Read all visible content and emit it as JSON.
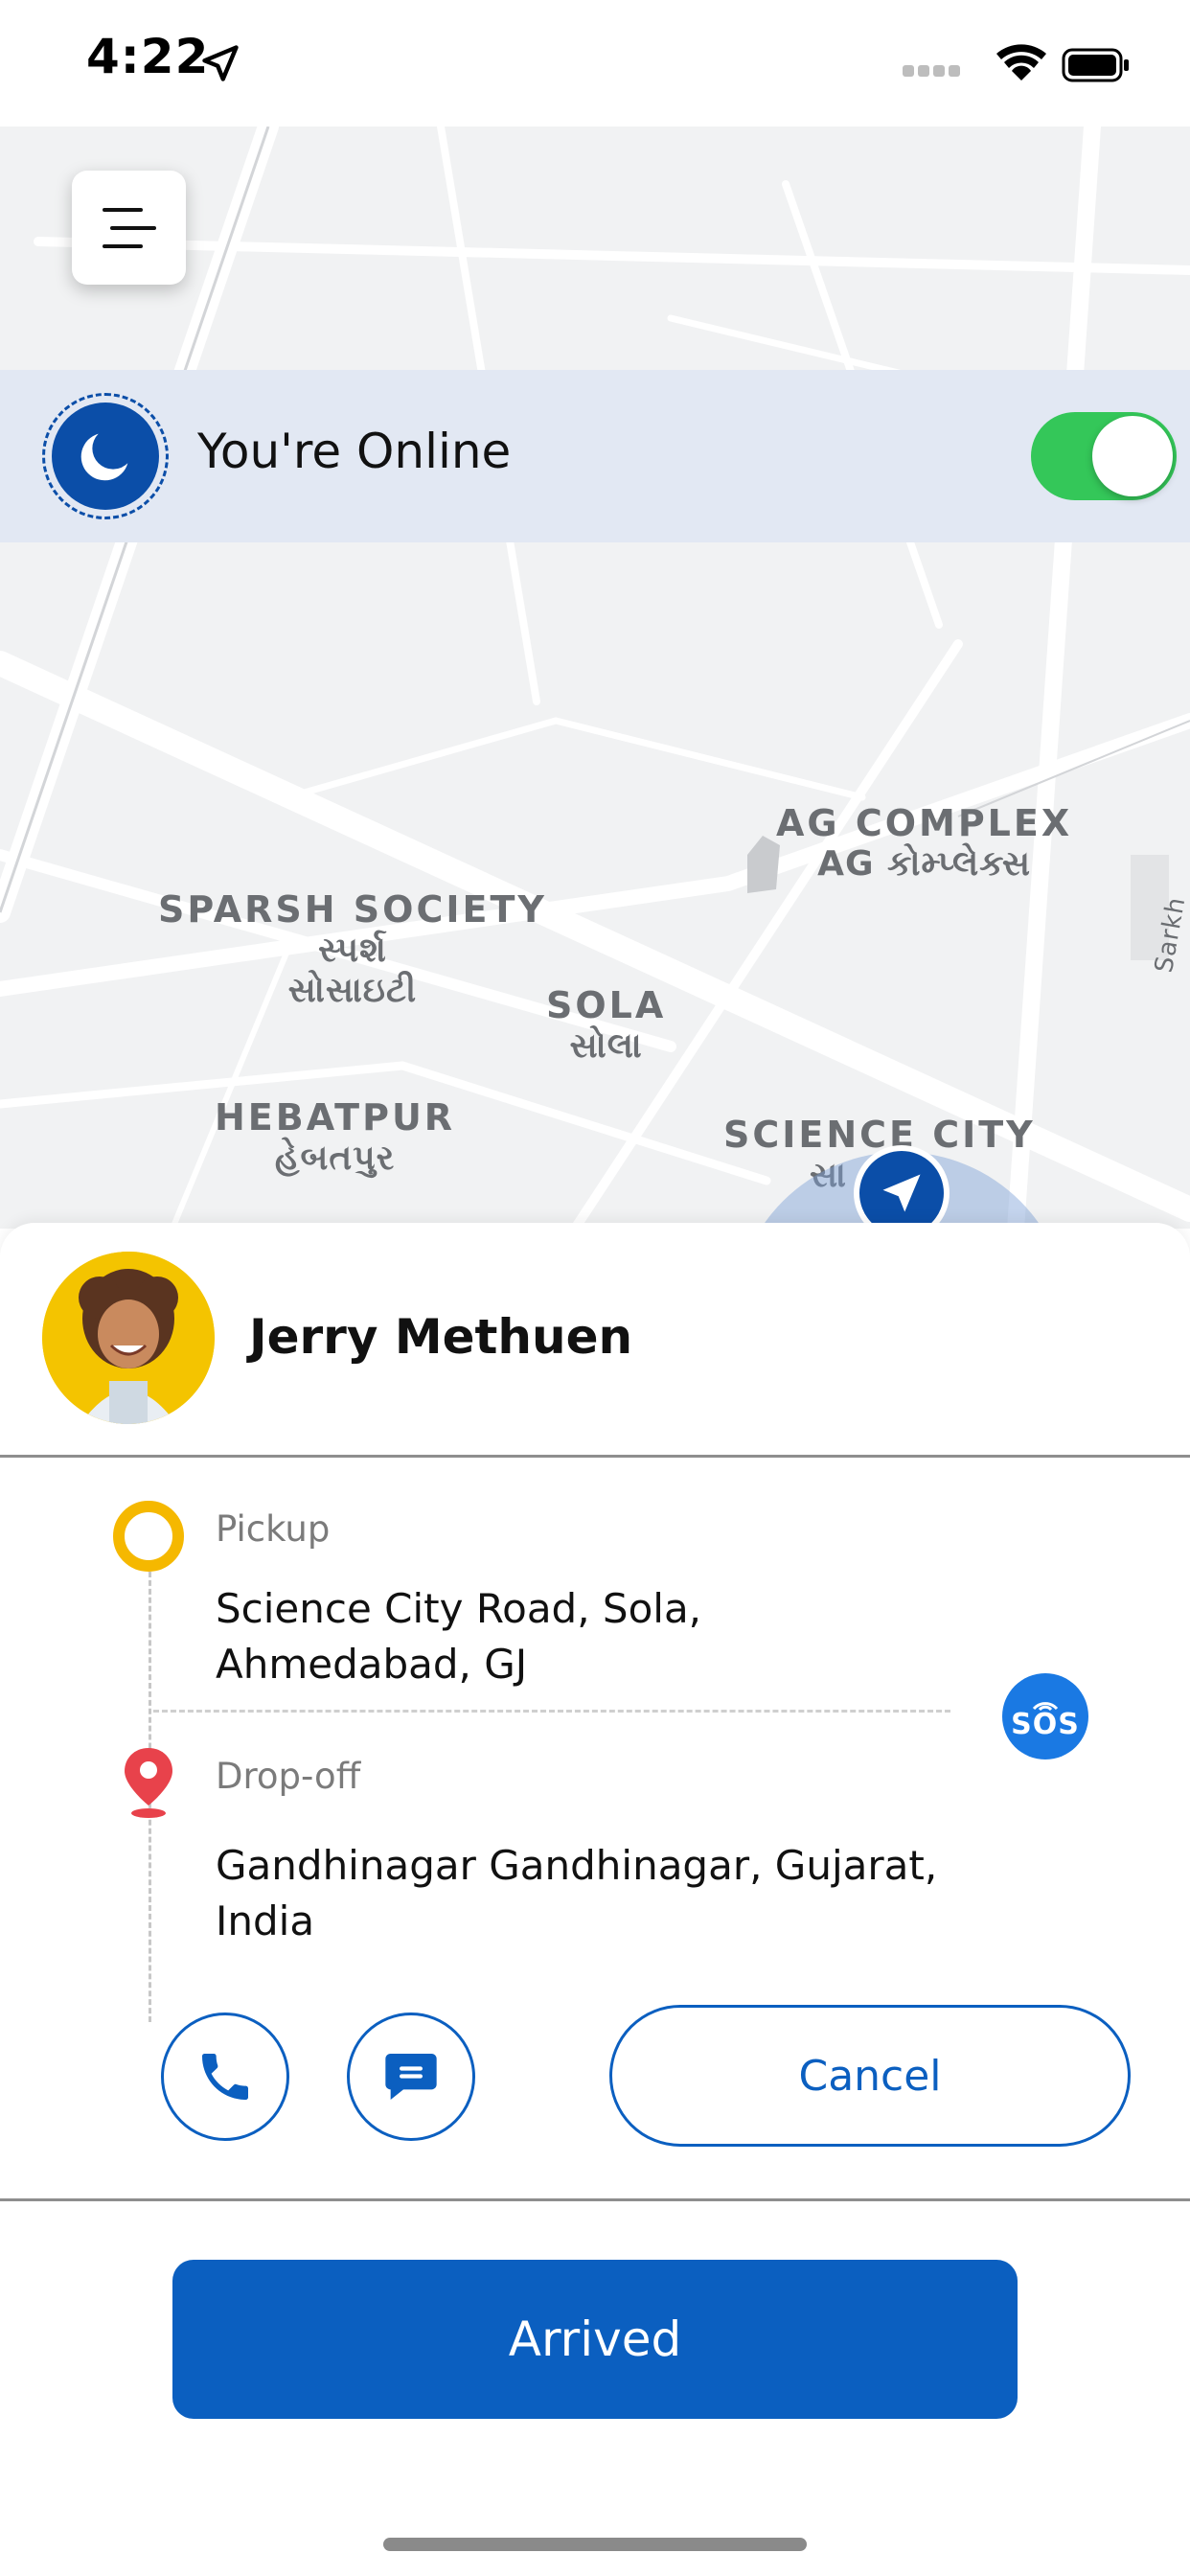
{
  "status_bar": {
    "time": "4:22"
  },
  "map": {
    "labels": [
      {
        "line1": "AG COMPLEX",
        "line2": "AG કોમ્પ્લેક્સ"
      },
      {
        "line1": "SPARSH SOCIETY",
        "line2": "સ્પર્શ",
        "line3": "સોસાઇટી"
      },
      {
        "line1": "SOLA",
        "line2": "સોલા"
      },
      {
        "line1": "HEBATPUR",
        "line2": "હેબતપુર"
      },
      {
        "line1": "SCIENCE CITY",
        "line2": "સા"
      },
      {
        "line1": "Sarkh"
      }
    ]
  },
  "online_banner": {
    "text": "You're Online",
    "toggle_on": true
  },
  "rider": {
    "name": "Jerry Methuen"
  },
  "trip": {
    "pickup_label": "Pickup",
    "pickup_address": "Science City Road, Sola, Ahmedabad, GJ",
    "dropoff_label": "Drop-off",
    "dropoff_address": "Gandhinagar Gandhinagar, Gujarat, India",
    "sos_label": "SOS"
  },
  "actions": {
    "cancel_label": "Cancel",
    "arrived_label": "Arrived"
  },
  "icons": {
    "menu": "menu-icon",
    "moon": "moon-icon",
    "location": "location-arrow-icon",
    "call": "phone-icon",
    "chat": "chat-icon",
    "sos": "sos-icon",
    "dropoff": "map-pin-icon"
  },
  "colors": {
    "primary": "#0b5fc0",
    "pickup": "#f5b800",
    "dropoff": "#e8424b",
    "toggle": "#34c759",
    "sos": "#1a79e3"
  }
}
